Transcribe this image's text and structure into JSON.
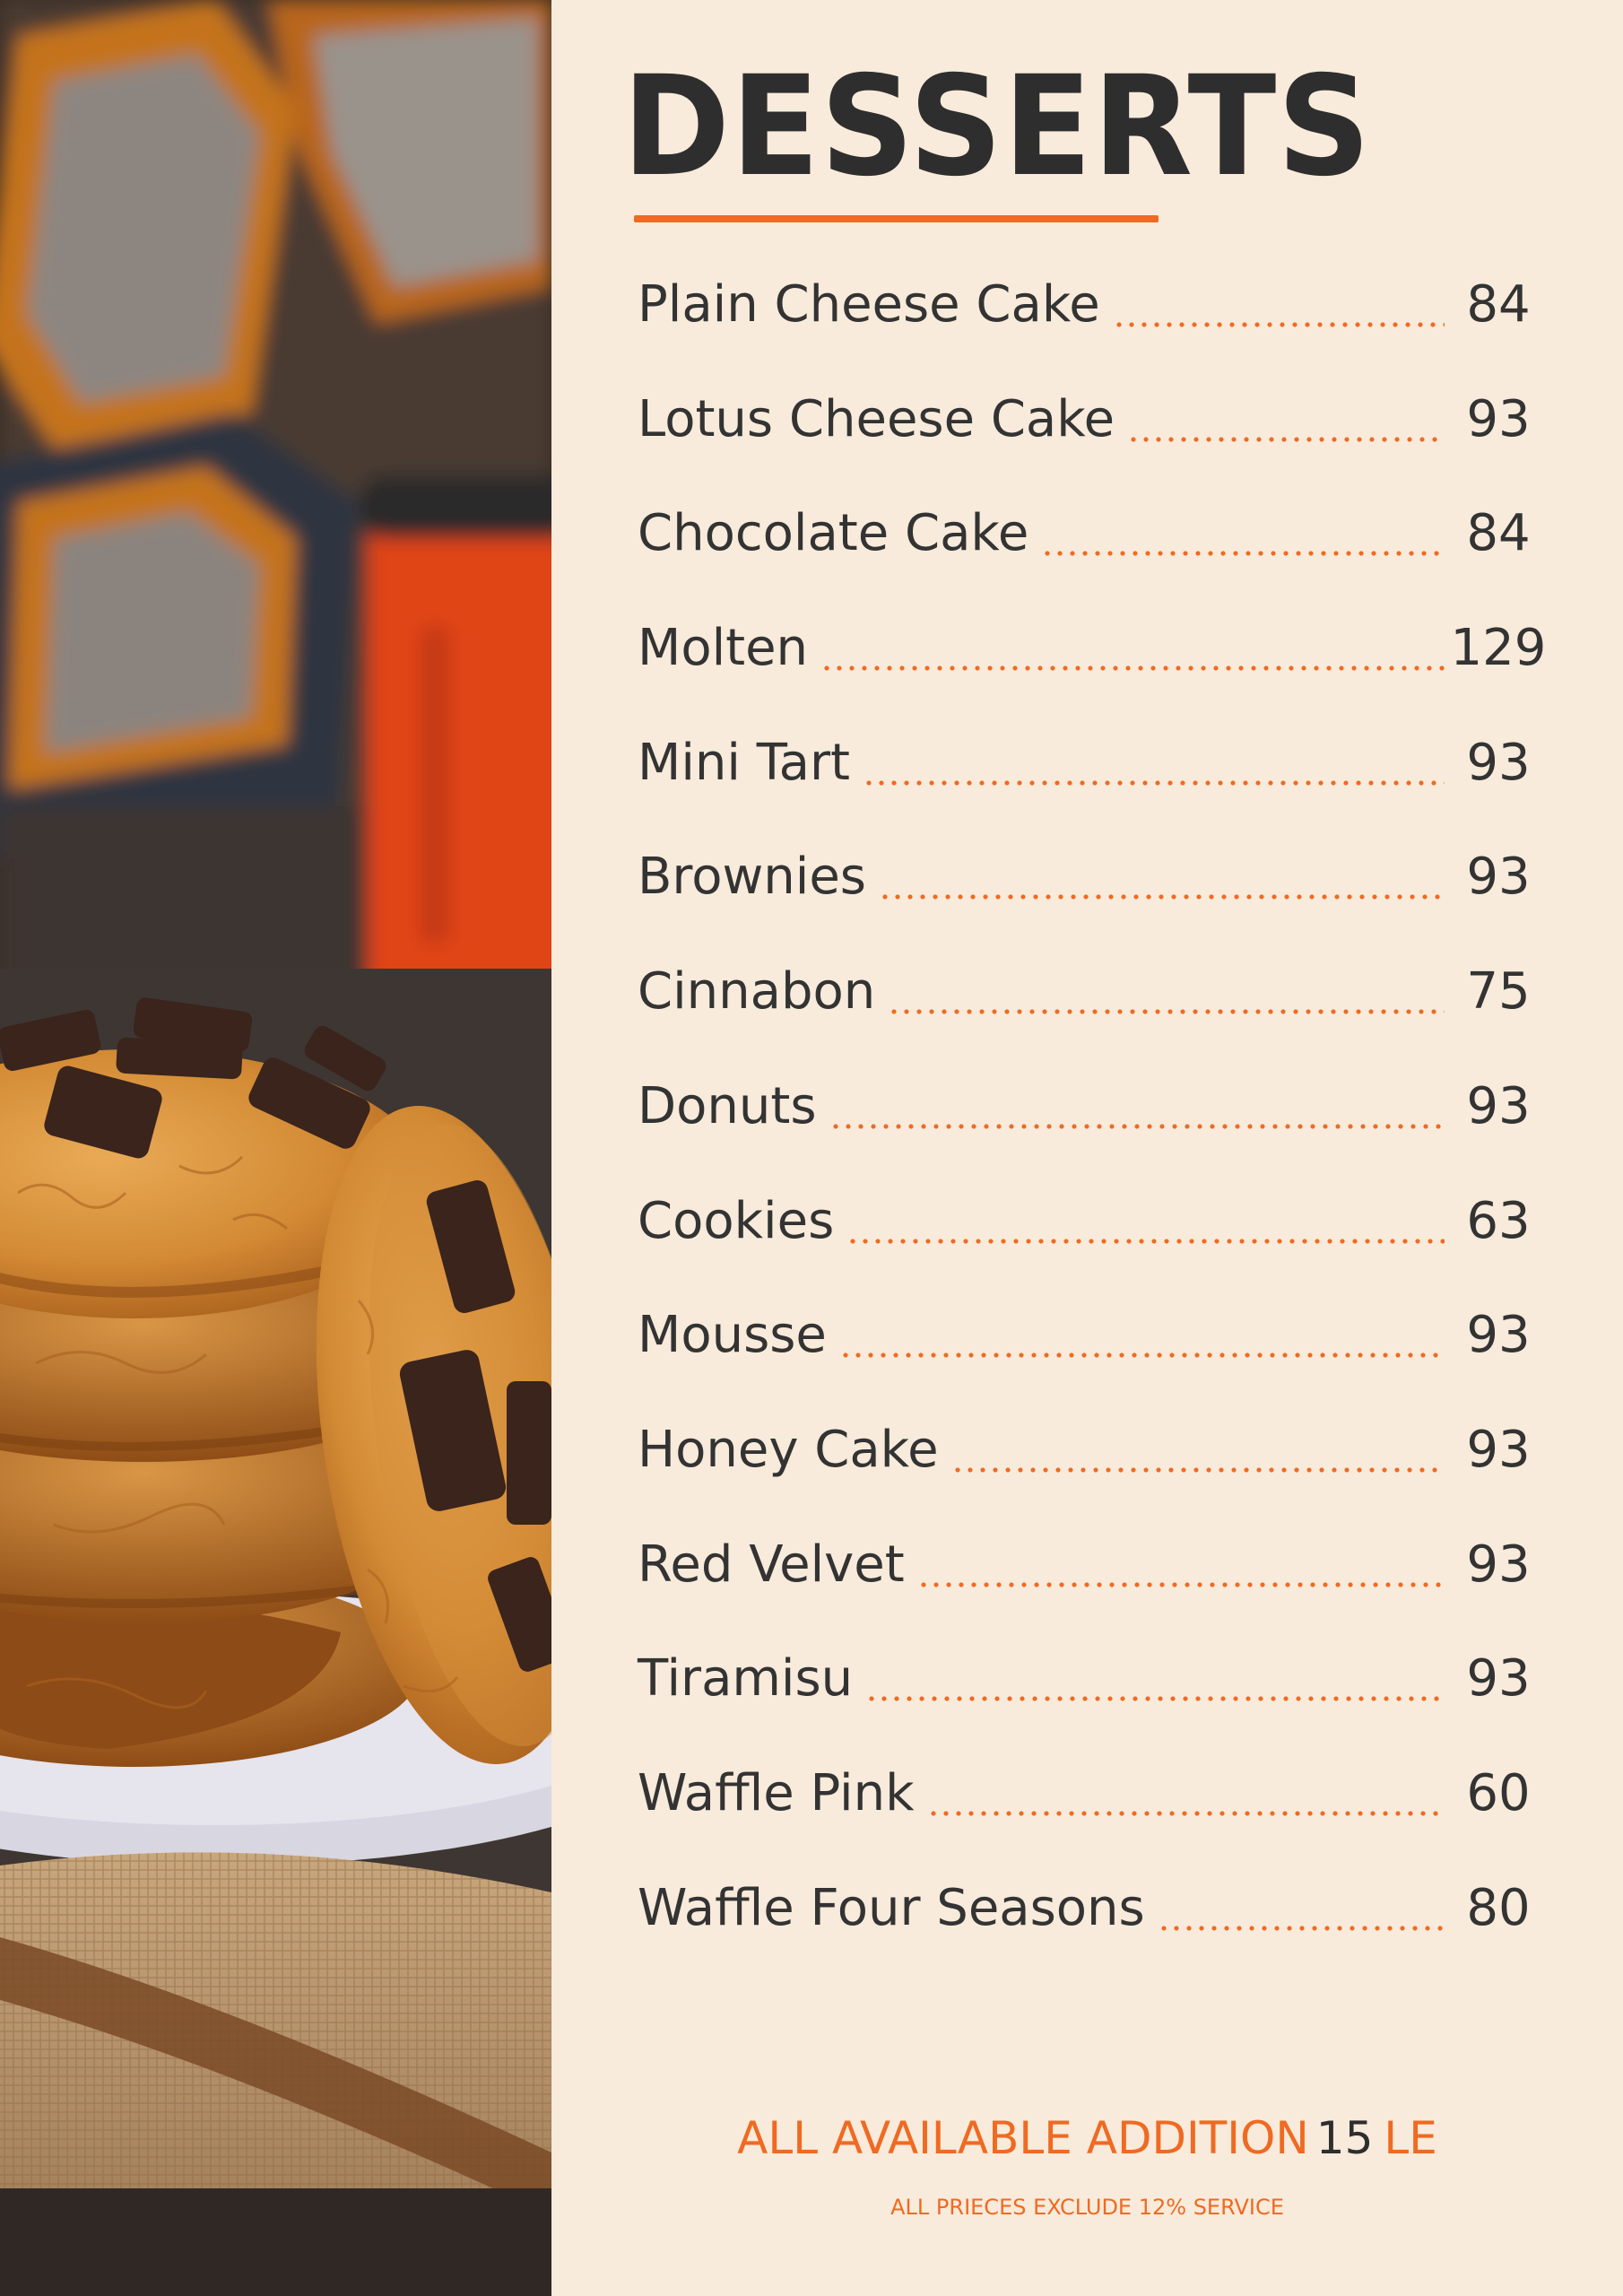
{
  "menu": {
    "title": "DESSERTS",
    "items": [
      {
        "name": "Plain Cheese Cake",
        "price": "84"
      },
      {
        "name": "Lotus Cheese Cake",
        "price": "93"
      },
      {
        "name": "Chocolate Cake",
        "price": "84"
      },
      {
        "name": "Molten",
        "price": "129"
      },
      {
        "name": "Mini Tart",
        "price": "93"
      },
      {
        "name": "Brownies",
        "price": "93"
      },
      {
        "name": "Cinnabon",
        "price": "75"
      },
      {
        "name": "Donuts",
        "price": "93"
      },
      {
        "name": "Cookies",
        "price": "63"
      },
      {
        "name": "Mousse",
        "price": "93"
      },
      {
        "name": "Honey Cake",
        "price": "93"
      },
      {
        "name": "Red Velvet",
        "price": "93"
      },
      {
        "name": "Tiramisu",
        "price": "93"
      },
      {
        "name": "Waffle Pink",
        "price": "60"
      },
      {
        "name": "Waffle Four Seasons",
        "price": "80"
      }
    ],
    "addition": {
      "label": "ALL AVAILABLE ADDITION",
      "amount": "15",
      "currency": "LE"
    },
    "note": "ALL PRIECES EXCLUDE 12% SERVICE"
  },
  "colors": {
    "accent": "#ef6a22",
    "text": "#333333",
    "background": "#f8ebdb"
  },
  "photo": {
    "subject": "chocolate-chunk-cookies-photo"
  }
}
